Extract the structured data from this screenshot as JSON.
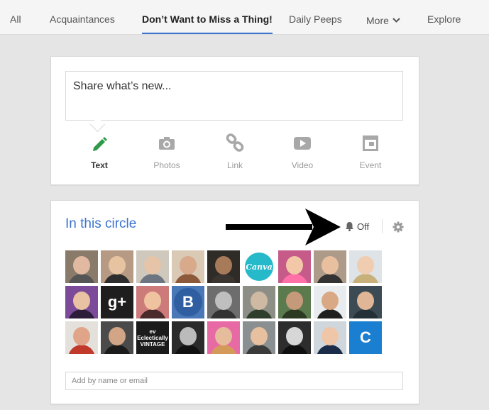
{
  "nav": {
    "tabs": [
      {
        "label": "All"
      },
      {
        "label": "Acquaintances"
      },
      {
        "label": "Don’t Want to Miss a Thing!"
      },
      {
        "label": "Daily Peeps"
      },
      {
        "label": "More",
        "icon": "chevron-down-icon"
      },
      {
        "label": "Explore"
      }
    ],
    "active_index": 2,
    "accent": "#3b73d0"
  },
  "share": {
    "prompt": "Share what’s new...",
    "options": [
      {
        "label": "Text",
        "icon": "pencil-icon",
        "color": "#2e9a4a"
      },
      {
        "label": "Photos",
        "icon": "camera-icon"
      },
      {
        "label": "Link",
        "icon": "link-icon"
      },
      {
        "label": "Video",
        "icon": "video-play-icon"
      },
      {
        "label": "Event",
        "icon": "calendar-icon"
      }
    ]
  },
  "circle": {
    "title": "In this circle",
    "notifications": {
      "label": "Off",
      "icon": "bell-icon"
    },
    "settings_icon": "gear-icon",
    "avatars": [
      {
        "bg": "#8a7a6a",
        "skin": "#e0b9a0",
        "shirt": "#555"
      },
      {
        "bg": "#b79a83",
        "skin": "#e8c3a2",
        "shirt": "#2d2d2d"
      },
      {
        "bg": "#cfc8bd",
        "skin": "#e6c4a8",
        "shirt": "#6c7580"
      },
      {
        "bg": "#d9c9b5",
        "skin": "#d8a98a",
        "shirt": "#8c5a3a"
      },
      {
        "bg": "#2f2b27",
        "skin": "#a77a5a",
        "shirt": "#3a3530"
      },
      {
        "bg": "#ffffff",
        "text": "Canva",
        "circle": "#25b9c9"
      },
      {
        "bg": "#c65a88",
        "skin": "#f2c8a8",
        "shirt": "#ff6fa8"
      },
      {
        "bg": "#ad9a88",
        "skin": "#e8c0a0",
        "shirt": "#333"
      },
      {
        "bg": "#dde3e6",
        "skin": "#f0cdb0",
        "shirt": "#c7b07a"
      },
      {
        "bg": "#7b4b9a",
        "skin": "#e9c2a4",
        "shirt": "#2d1d3a"
      },
      {
        "bg": "#1e1e1e",
        "skin": "#cfcfcf",
        "shirt": "#111",
        "text": "g+"
      },
      {
        "bg": "#cc7a7a",
        "skin": "#efc2a0",
        "shirt": "#4a2a2a"
      },
      {
        "bg": "#4a77b5",
        "text": "B",
        "circle": "#2f5fa0"
      },
      {
        "bg": "#6d6d6d",
        "skin": "#bfbfbf",
        "shirt": "#333"
      },
      {
        "bg": "#8d8f87",
        "skin": "#d0b9a3",
        "shirt": "#2f3e2c"
      },
      {
        "bg": "#5b7a4e",
        "skin": "#c59a7a",
        "shirt": "#2c3a24"
      },
      {
        "bg": "#e9ecef",
        "skin": "#d9a985",
        "shirt": "#1f1f1f"
      },
      {
        "bg": "#3c4a54",
        "skin": "#e0b696",
        "shirt": "#243038"
      },
      {
        "bg": "#e4e0dc",
        "skin": "#e0a588",
        "shirt": "#c0392b"
      },
      {
        "bg": "#4a4a4a",
        "skin": "#d1a585",
        "shirt": "#1b1b1b"
      },
      {
        "bg": "#1b1b1b",
        "text": "ev Eclectically VINTAGE"
      },
      {
        "bg": "#2a2a2a",
        "skin": "#bbbbbb",
        "shirt": "#111"
      },
      {
        "bg": "#e86aa5",
        "skin": "#e6bd9c",
        "shirt": "#d49a5a"
      },
      {
        "bg": "#8a8f92",
        "skin": "#e7c09f",
        "shirt": "#3a3a3a"
      },
      {
        "bg": "#2d2d2d",
        "skin": "#d7d7d7",
        "shirt": "#101010"
      },
      {
        "bg": "#cfd6dc",
        "skin": "#f0c6a8",
        "shirt": "#1b2c4a"
      },
      {
        "bg": "#1a7fd1",
        "text": "C"
      }
    ],
    "add_placeholder": "Add by name or email"
  }
}
